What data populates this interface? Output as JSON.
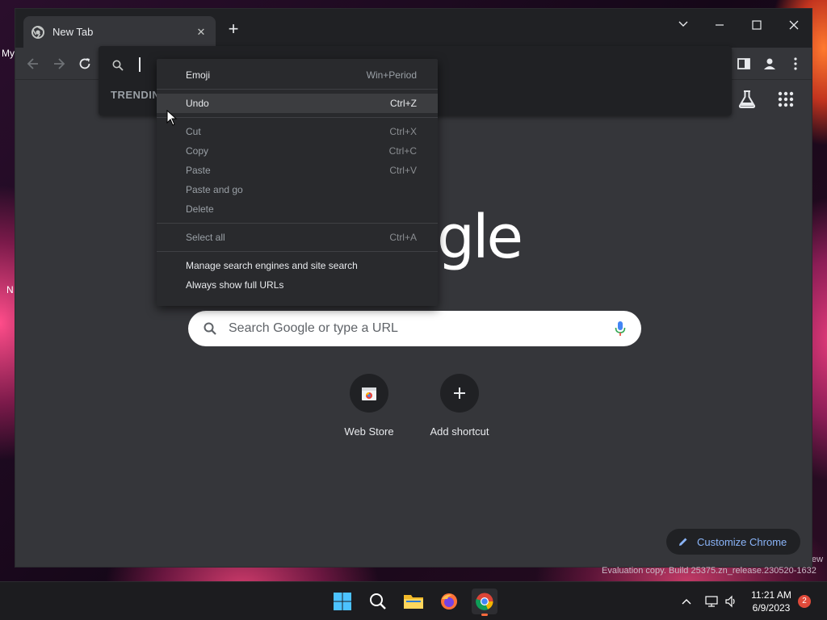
{
  "desktop": {
    "label_fragment_top": "My",
    "label_fragment_side": "N",
    "watermark_right": "ew",
    "watermark": "Evaluation copy. Build 25375.zn_release.230520-1632"
  },
  "browser": {
    "tab": {
      "title": "New Tab"
    },
    "omnibox": {
      "value": "",
      "section_header": "TRENDIN"
    },
    "ntp": {
      "logo_visible": "gle",
      "search_placeholder": "Search Google or type a URL",
      "shortcuts": [
        {
          "label": "Web Store"
        },
        {
          "label": "Add shortcut"
        }
      ],
      "customize_label": "Customize Chrome"
    }
  },
  "context_menu": {
    "emoji": {
      "label": "Emoji",
      "shortcut": "Win+Period"
    },
    "undo": {
      "label": "Undo",
      "shortcut": "Ctrl+Z"
    },
    "cut": {
      "label": "Cut",
      "shortcut": "Ctrl+X"
    },
    "copy": {
      "label": "Copy",
      "shortcut": "Ctrl+C"
    },
    "paste": {
      "label": "Paste",
      "shortcut": "Ctrl+V"
    },
    "paste_and_go": {
      "label": "Paste and go"
    },
    "delete": {
      "label": "Delete"
    },
    "select_all": {
      "label": "Select all",
      "shortcut": "Ctrl+A"
    },
    "manage_search": {
      "label": "Manage search engines and site search"
    },
    "always_full_urls": {
      "label": "Always show full URLs"
    }
  },
  "taskbar": {
    "time": "11:21 AM",
    "date": "6/9/2023",
    "notification_count": "2"
  },
  "colors": {
    "accent_link": "#8ab4f8",
    "menu_bg": "#292a2d",
    "window_bg": "#35363a",
    "titlebar_bg": "#202124"
  }
}
